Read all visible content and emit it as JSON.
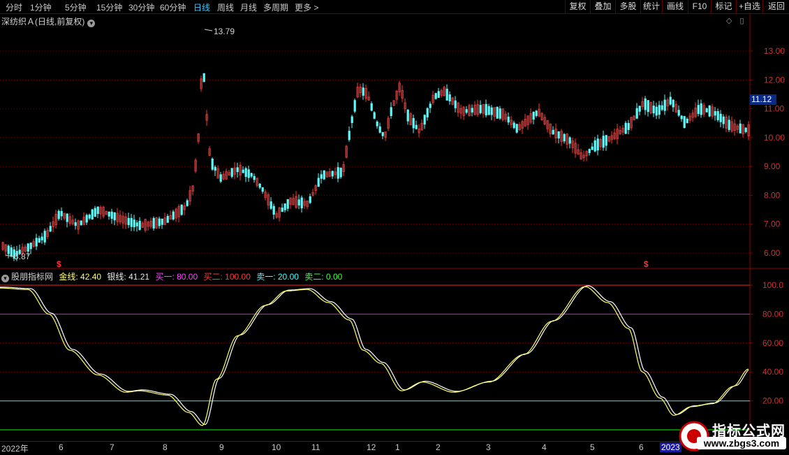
{
  "toolbar": {
    "periods": [
      {
        "label": "分时",
        "active": false
      },
      {
        "label": "1分钟",
        "active": false
      },
      {
        "label": "5分钟",
        "active": false
      },
      {
        "label": "15分钟",
        "active": false
      },
      {
        "label": "30分钟",
        "active": false
      },
      {
        "label": "60分钟",
        "active": false
      },
      {
        "label": "日线",
        "active": true
      },
      {
        "label": "周线",
        "active": false
      },
      {
        "label": "月线",
        "active": false
      },
      {
        "label": "多周期",
        "active": false
      },
      {
        "label": "更多 >",
        "active": false
      }
    ],
    "right_buttons": [
      "复权",
      "叠加",
      "多股",
      "统计",
      "画线",
      "F10",
      "标记",
      "+自选",
      "返回"
    ]
  },
  "stock": {
    "title": "深纺织Ａ(日线,前复权)",
    "last_price_tag": "11.12",
    "high_label": "13.79",
    "low_label": "5.87",
    "price_axis": [
      "13.00",
      "12.00",
      "11.00",
      "10.00",
      "9.00",
      "8.00",
      "7.00",
      "6.00"
    ]
  },
  "indicator": {
    "name": "股朋指标网",
    "gold_label": "金线: 42.40",
    "silver_label": "银线: 41.21",
    "buy1_label": "买一: 80.00",
    "buy2_label": "买二: 100.00",
    "sell1_label": "卖一: 20.00",
    "sell2_label": "卖二: 0.00",
    "axis": [
      "100.0",
      "80.00",
      "60.00",
      "40.00",
      "20.00"
    ]
  },
  "xaxis": [
    "2022年",
    "6",
    "7",
    "8",
    "9",
    "10",
    "11",
    "12",
    "1",
    "2",
    "3",
    "4",
    "5",
    "6",
    "2023"
  ],
  "markers": [
    "$",
    "$"
  ],
  "watermark": {
    "title": "指标公式网",
    "url": "www.zbgs3.com"
  },
  "colors": {
    "up": "#ff3232",
    "down": "#54ffff",
    "gold": "#ffff66",
    "silver": "#ffffff",
    "buy_line": "#ff00ff",
    "sell_line": "#00ffff",
    "zero_line": "#00ff00",
    "grid": "#7a0000"
  }
}
